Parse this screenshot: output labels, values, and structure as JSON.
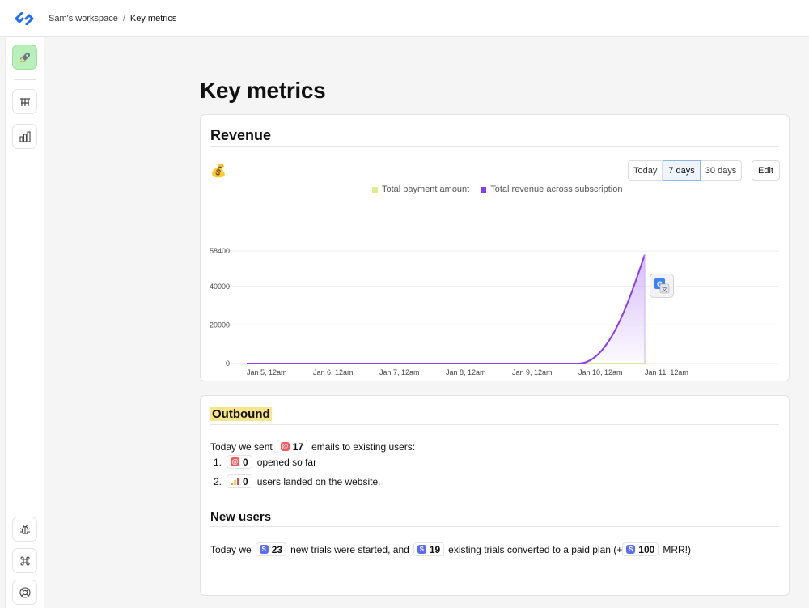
{
  "breadcrumb": {
    "workspace": "Sam's workspace",
    "separator": "/",
    "current": "Key metrics"
  },
  "sidebar": {
    "items": [
      {
        "icon": "rocket-icon"
      },
      {
        "icon": "org-chart-icon"
      },
      {
        "icon": "bar-chart-icon"
      },
      {
        "icon": "bug-icon"
      },
      {
        "icon": "command-icon"
      },
      {
        "icon": "lifebuoy-icon"
      }
    ]
  },
  "page": {
    "title": "Key metrics"
  },
  "revenue": {
    "title": "Revenue",
    "emoji": "💰",
    "range_options": [
      "Today",
      "7 days",
      "30 days"
    ],
    "selected_range": "7 days",
    "edit_label": "Edit"
  },
  "chart_data": {
    "type": "area",
    "series": [
      {
        "name": "Total payment amount",
        "color": "#dcef8e",
        "values": [
          0,
          0,
          0,
          0,
          0,
          0,
          0
        ]
      },
      {
        "name": "Total revenue across subscription",
        "color": "#8b3cf0",
        "values": [
          0,
          0,
          0,
          0,
          0,
          0,
          56500
        ]
      }
    ],
    "x": [
      "Jan 5, 12am",
      "Jan 6, 12am",
      "Jan 7, 12am",
      "Jan 8, 12am",
      "Jan 9, 12am",
      "Jan 10, 12am",
      "Jan 11, 12am"
    ],
    "y_ticks": [
      0,
      20000,
      40000,
      58400
    ],
    "y_tick_labels": [
      "0",
      "20000",
      "40000",
      "58400"
    ],
    "ylim": [
      0,
      58400
    ],
    "grid": true,
    "legend": "top-center"
  },
  "outbound": {
    "title": "Outbound",
    "sent_prefix": "Today we sent",
    "sent_count": "17",
    "sent_suffix": "emails to existing users:",
    "items": [
      {
        "num": "1.",
        "value": "0",
        "label": "opened so far"
      },
      {
        "num": "2.",
        "value": "0",
        "label": "users landed on the website."
      }
    ]
  },
  "new_users": {
    "title": "New users",
    "p1": "Today we",
    "trials": "23",
    "p2": "new trials were started, and",
    "converted": "19",
    "p3": "existing trials converted to a paid plan (+",
    "mrr": "100",
    "p4": "MRR!)"
  }
}
